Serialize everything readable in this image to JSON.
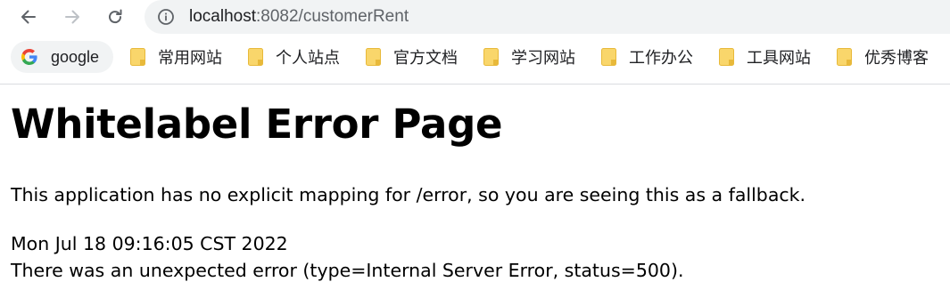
{
  "browser": {
    "url_host": "localhost",
    "url_rest": ":8082/customerRent",
    "bookmarks": [
      {
        "label": "google",
        "icon": "google-icon"
      },
      {
        "label": "常用网站",
        "icon": "folder-icon"
      },
      {
        "label": "个人站点",
        "icon": "folder-icon"
      },
      {
        "label": "官方文档",
        "icon": "folder-icon"
      },
      {
        "label": "学习网站",
        "icon": "folder-icon"
      },
      {
        "label": "工作办公",
        "icon": "folder-icon"
      },
      {
        "label": "工具网站",
        "icon": "folder-icon"
      },
      {
        "label": "优秀博客",
        "icon": "folder-icon"
      }
    ]
  },
  "page": {
    "title": "Whitelabel Error Page",
    "message": "This application has no explicit mapping for /error, so you are seeing this as a fallback.",
    "timestamp": "Mon Jul 18 09:16:05 CST 2022",
    "error_detail": "There was an unexpected error (type=Internal Server Error, status=500)."
  },
  "colors": {
    "folder": "#f9d66b",
    "toolbar_bg": "#f1f3f4",
    "text": "#000000"
  }
}
